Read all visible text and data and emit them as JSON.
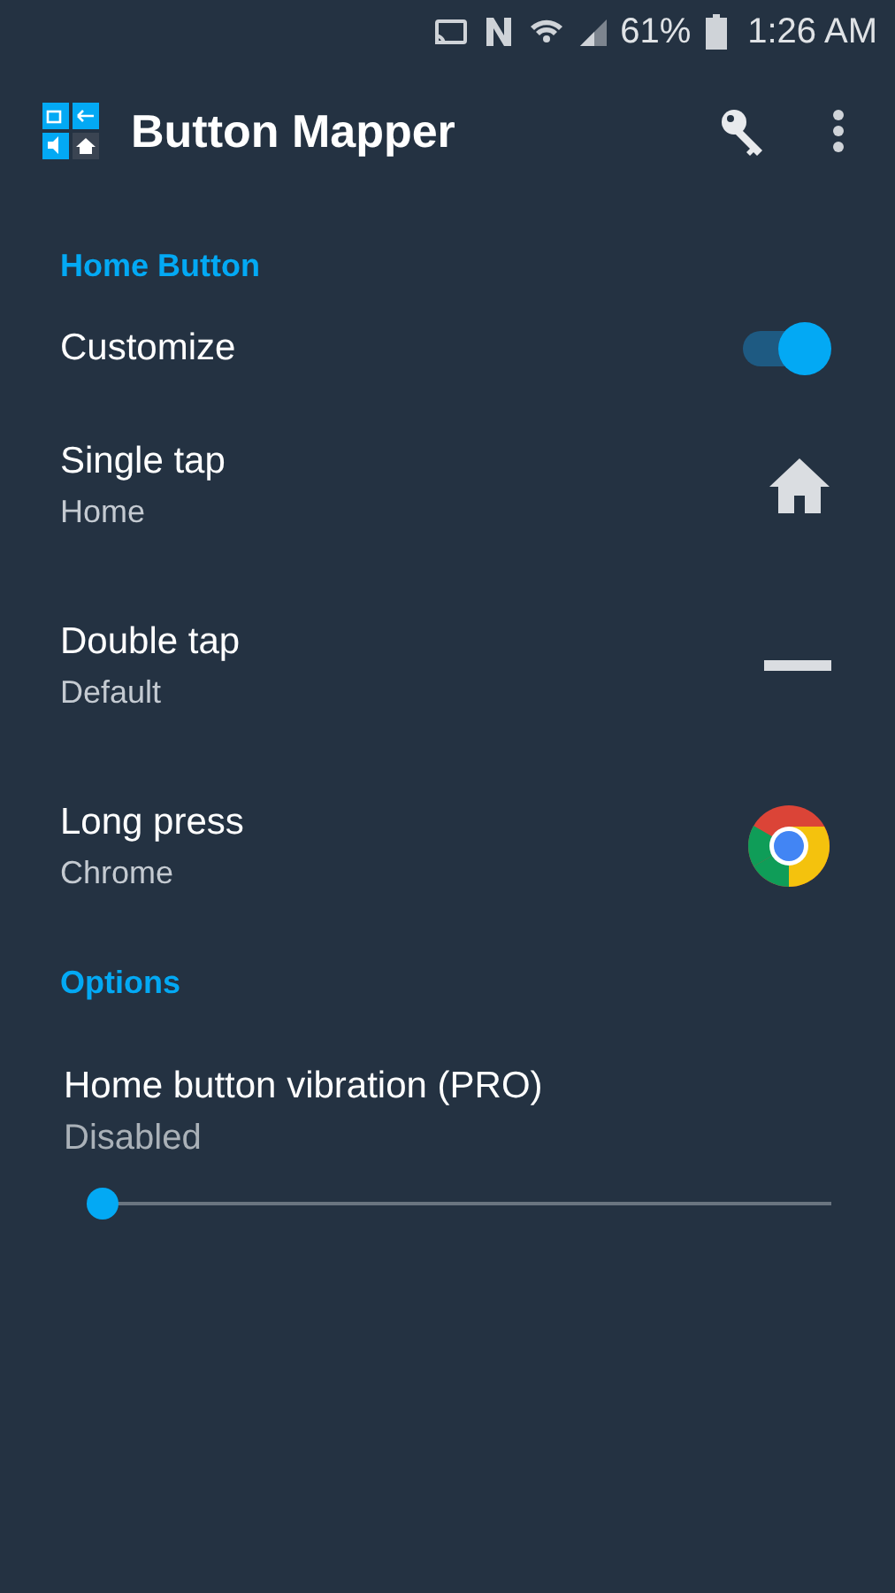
{
  "status_bar": {
    "battery": "61%",
    "time": "1:26 AM"
  },
  "toolbar": {
    "title": "Button Mapper"
  },
  "sections": [
    {
      "header": "Home Button",
      "items": [
        {
          "kind": "toggle",
          "title": "Customize",
          "on": true
        },
        {
          "kind": "home",
          "title": "Single tap",
          "summary": "Home"
        },
        {
          "kind": "blank",
          "title": "Double tap",
          "summary": "Default"
        },
        {
          "kind": "app",
          "title": "Long press",
          "summary": "Chrome"
        }
      ]
    },
    {
      "header": "Options",
      "items": [
        {
          "kind": "slider",
          "title": "Home button vibration (PRO)",
          "summary": "Disabled",
          "level": 0
        }
      ]
    }
  ]
}
